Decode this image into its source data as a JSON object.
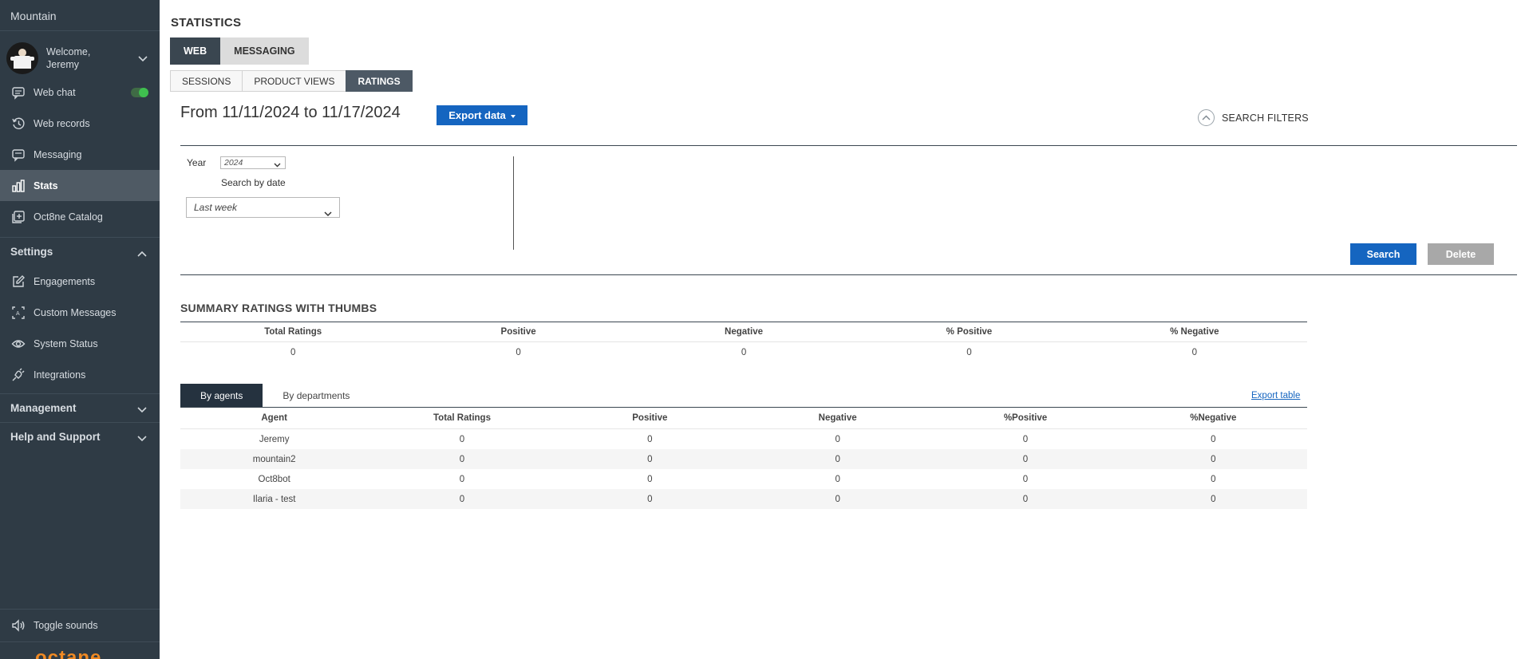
{
  "app": {
    "company": "Mountain",
    "welcome_line1": "Welcome,",
    "welcome_line2": "Jeremy",
    "logo_text": "octane"
  },
  "sidebar": {
    "items": [
      {
        "label": "Web chat",
        "icon": "chat-icon",
        "toggle_on": true
      },
      {
        "label": "Web records",
        "icon": "history-icon"
      },
      {
        "label": "Messaging",
        "icon": "message-icon"
      },
      {
        "label": "Stats",
        "icon": "bar-chart-icon",
        "active": true
      },
      {
        "label": "Oct8ne Catalog",
        "icon": "catalog-icon"
      }
    ],
    "settings_label": "Settings",
    "settings_items": [
      {
        "label": "Engagements",
        "icon": "edit-icon"
      },
      {
        "label": "Custom Messages",
        "icon": "custom-message-icon"
      },
      {
        "label": "System Status",
        "icon": "eye-icon"
      },
      {
        "label": "Integrations",
        "icon": "plug-icon"
      }
    ],
    "management_label": "Management",
    "help_label": "Help and Support",
    "toggle_sounds": "Toggle sounds"
  },
  "header": {
    "title": "STATISTICS",
    "tabs": [
      "WEB",
      "MESSAGING"
    ],
    "subtabs": [
      "SESSIONS",
      "PRODUCT VIEWS",
      "RATINGS"
    ]
  },
  "range": {
    "text": "From 11/11/2024 to 11/17/2024",
    "export_label": "Export data",
    "filters_label": "SEARCH FILTERS"
  },
  "filters": {
    "year_label": "Year",
    "year_value": "2024",
    "search_by_date_label": "Search by date",
    "period_value": "Last week",
    "search_button": "Search",
    "delete_button": "Delete"
  },
  "summary": {
    "title": "SUMMARY RATINGS WITH THUMBS",
    "headers": [
      "Total Ratings",
      "Positive",
      "Negative",
      "% Positive",
      "% Negative"
    ],
    "values": [
      "0",
      "0",
      "0",
      "0",
      "0"
    ]
  },
  "breakdown": {
    "tabs": [
      "By agents",
      "By departments"
    ],
    "export_label": "Export table",
    "headers": [
      "Agent",
      "Total Ratings",
      "Positive",
      "Negative",
      "%Positive",
      "%Negative"
    ],
    "rows": [
      [
        "Jeremy",
        "0",
        "0",
        "0",
        "0",
        "0"
      ],
      [
        "mountain2",
        "0",
        "0",
        "0",
        "0",
        "0"
      ],
      [
        "Oct8bot",
        "0",
        "0",
        "0",
        "0",
        "0"
      ],
      [
        "Ilaria - test",
        "0",
        "0",
        "0",
        "0",
        "0"
      ]
    ]
  },
  "colors": {
    "sidebar_bg": "#2f3b45",
    "accent_blue": "#1565c0",
    "active_tab": "#3a4650",
    "toggle_on": "#3fbf4f",
    "logo_orange": "#f08a24"
  }
}
